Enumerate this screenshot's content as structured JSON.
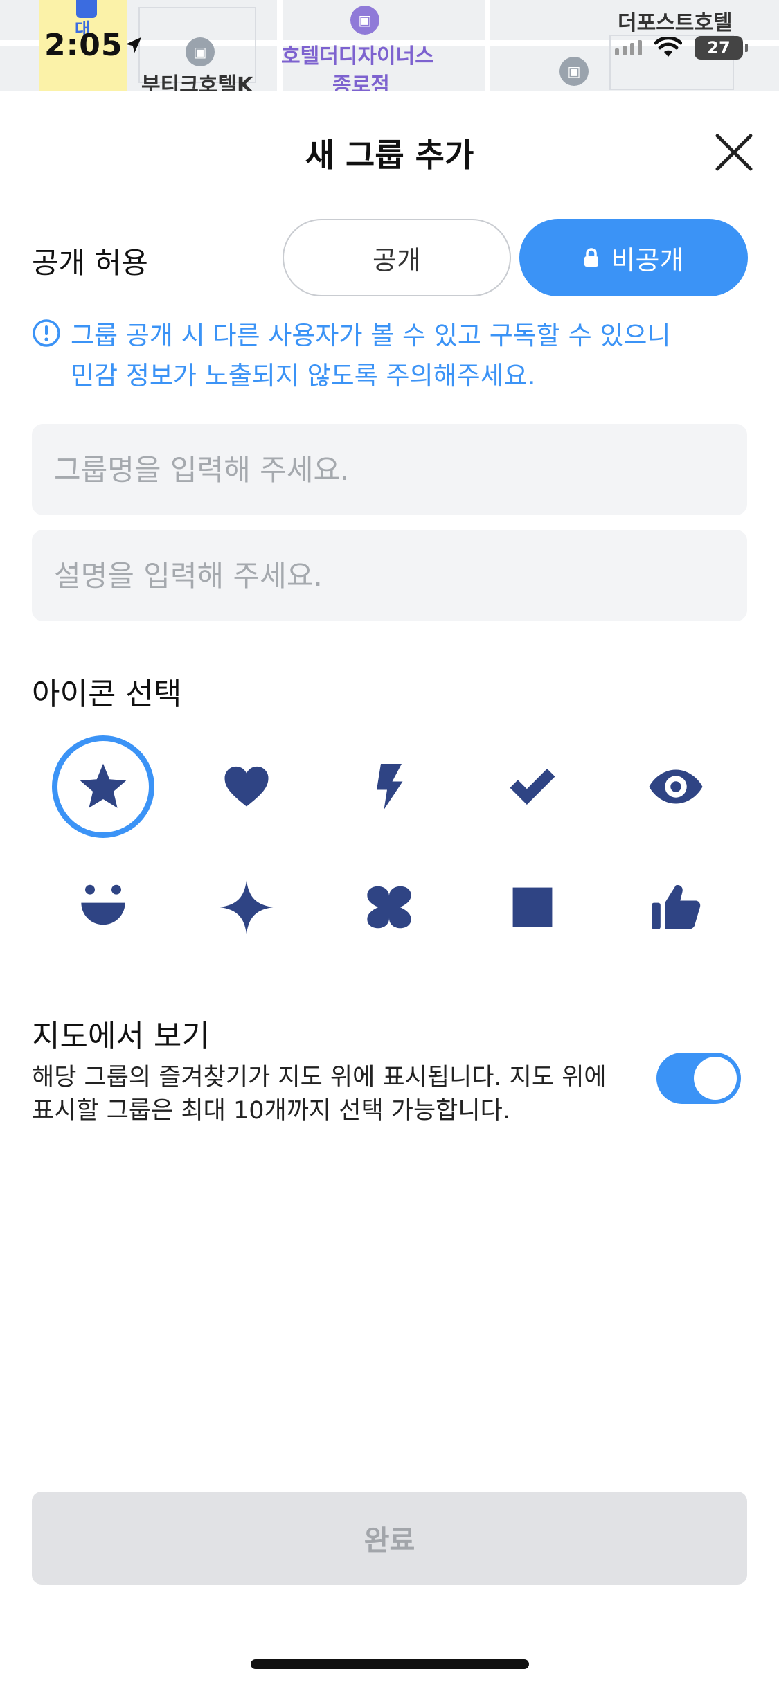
{
  "status_bar": {
    "time": "2:05",
    "battery": "27"
  },
  "map": {
    "labels": [
      "대",
      "부티크호텔K",
      "호텔더디자이너스",
      "종로점",
      "더포스트호텔"
    ]
  },
  "header": {
    "title": "새 그룹 추가"
  },
  "visibility": {
    "label": "공개 허용",
    "options": [
      "공개",
      "비공개"
    ],
    "selected": "비공개",
    "notice": "그룹 공개 시 다른 사용자가 볼 수 있고 구독할 수 있으니 민감 정보가 노출되지 않도록 주의해주세요.",
    "notice_line1": "그룹 공개 시 다른 사용자가 볼 수 있고 구독할 수 있으니",
    "notice_line2": "민감 정보가 노출되지 않도록 주의해주세요."
  },
  "form": {
    "name_placeholder": "그룹명을 입력해 주세요.",
    "name_value": "",
    "desc_placeholder": "설명을 입력해 주세요.",
    "desc_value": ""
  },
  "icon_picker": {
    "title": "아이콘 선택",
    "icons": [
      "star-icon",
      "heart-icon",
      "bolt-icon",
      "check-icon",
      "eye-icon",
      "smile-icon",
      "sparkle-icon",
      "clover-icon",
      "square-icon",
      "thumbs-up-icon"
    ],
    "selected": "star-icon"
  },
  "map_view": {
    "title": "지도에서 보기",
    "description_line1": "해당 그룹의 즐겨찾기가 지도 위에 표시됩니다. 지도 위에",
    "description_line2": "표시할 그룹은 최대 10개까지 선택 가능합니다.",
    "enabled": true
  },
  "footer": {
    "done_label": "완료"
  },
  "colors": {
    "accent": "#3b93f6",
    "icon": "#2f4484",
    "disabled_button": "#e1e2e5",
    "input_bg": "#f3f4f6"
  }
}
